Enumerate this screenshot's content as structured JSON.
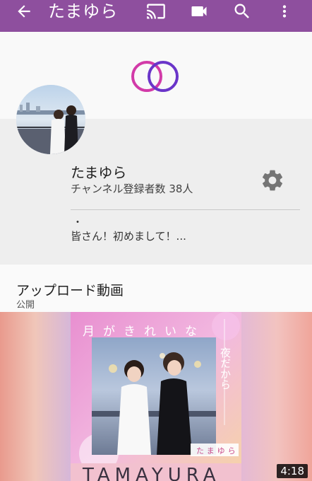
{
  "appbar": {
    "title": "たまゆら",
    "icons": [
      "back-arrow-icon",
      "cast-icon",
      "video-camera-icon",
      "search-icon",
      "more-vert-icon"
    ],
    "background": "#8e4f9e"
  },
  "channel": {
    "name": "たまゆら",
    "subscribers": "チャンネル登録者数 38人",
    "dot": "・",
    "description": "皆さん！初めまして！..."
  },
  "uploads": {
    "title": "アップロード動画",
    "subtitle": "公開"
  },
  "video": {
    "duration": "4:18",
    "cover_heading": "月がきれいな",
    "cover_vertical": "夜だから",
    "cover_logo": "たまゆら",
    "cover_bottom": "TAMAYURA"
  },
  "colors": {
    "ring_left": "#d23aa8",
    "ring_right": "#6a35c9"
  }
}
